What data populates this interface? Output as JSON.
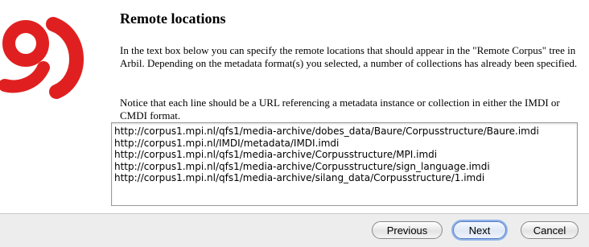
{
  "page": {
    "title": "Remote locations",
    "paragraph1": "In the text box below you can specify the remote locations that should appear in the \"Remote Corpus\" tree in Arbil. Depending on the metadata format(s) you selected, a number of collections has already been specified.",
    "paragraph2": "Notice that each line should be a URL referencing a metadata instance or collection in either the IMDI or CMDI format."
  },
  "locations": [
    "http://corpus1.mpi.nl/qfs1/media-archive/dobes_data/Baure/Corpusstructure/Baure.imdi",
    "http://corpus1.mpi.nl/IMDI/metadata/IMDI.imdi",
    "http://corpus1.mpi.nl/qfs1/media-archive/Corpusstructure/MPI.imdi",
    "http://corpus1.mpi.nl/qfs1/media-archive/Corpusstructure/sign_language.imdi",
    "http://corpus1.mpi.nl/qfs1/media-archive/silang_data/Corpusstructure/1.imdi"
  ],
  "buttons": {
    "previous": "Previous",
    "next": "Next",
    "cancel": "Cancel"
  },
  "colors": {
    "logo": "#e02020",
    "default_button_ring": "#8fb3ea"
  },
  "icons": {
    "logo": "arbil-logo-icon"
  }
}
